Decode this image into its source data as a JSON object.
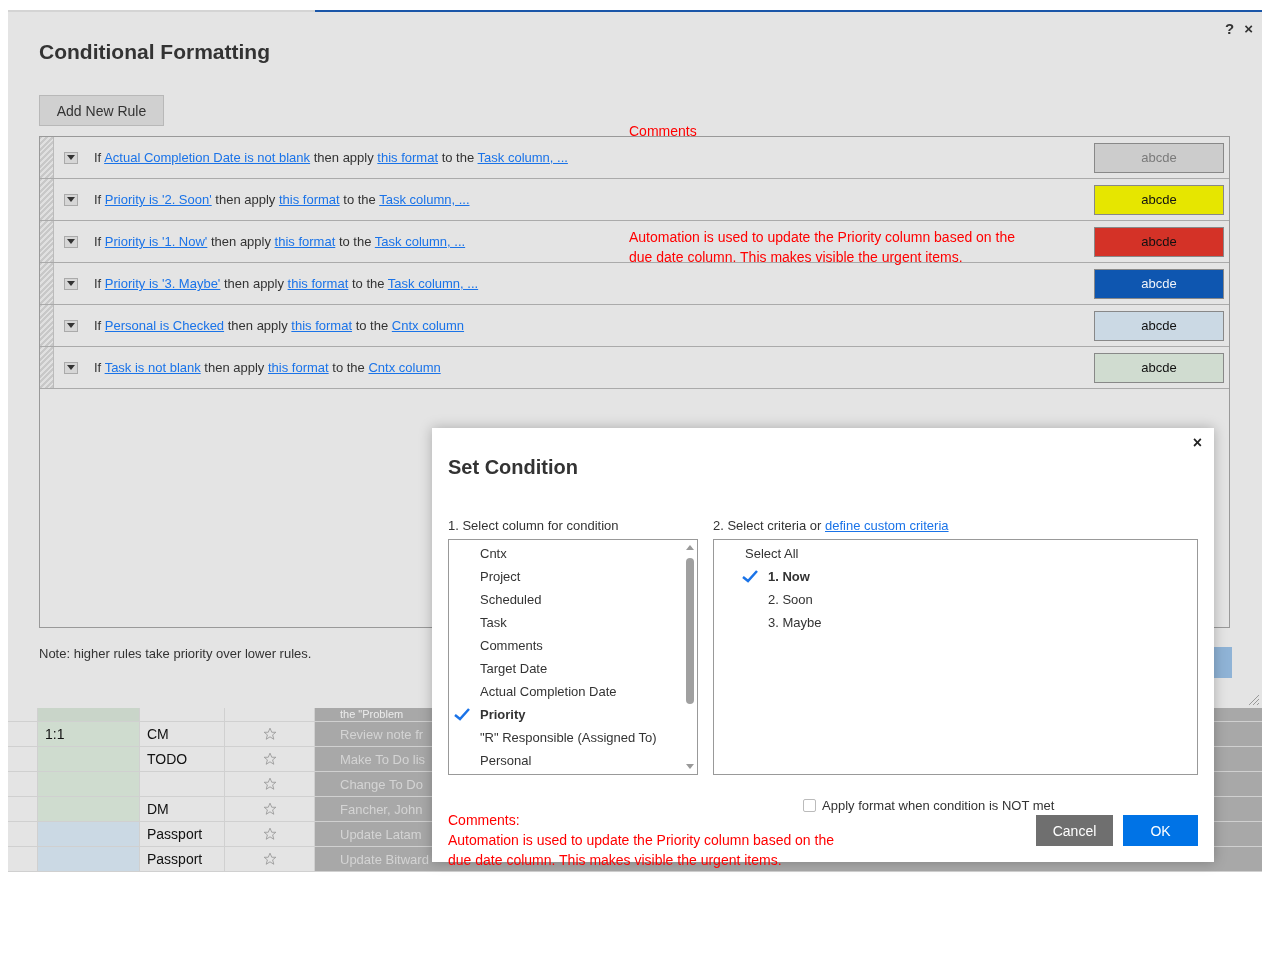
{
  "dialog": {
    "title": "Conditional Formatting",
    "help": "?",
    "close": "×",
    "add_button": "Add New Rule",
    "comment_label": "Comments",
    "comment_note": "Automation is used to update the Priority column based on the due date column.  This makes visible the urgent items.",
    "rules": [
      {
        "parts": [
          {
            "text": "If",
            "kind": "text"
          },
          {
            "text": "Actual Completion Date is not blank",
            "kind": "link"
          },
          {
            "text": "then apply",
            "kind": "text"
          },
          {
            "text": "this format",
            "kind": "link"
          },
          {
            "text": "to the",
            "kind": "text"
          },
          {
            "text": "Task column, ...",
            "kind": "link"
          }
        ],
        "sample": "abcde",
        "color": "#cccccc",
        "muted": true
      },
      {
        "parts": [
          {
            "text": "If",
            "kind": "text"
          },
          {
            "text": "Priority is '2. Soon'",
            "kind": "link"
          },
          {
            "text": "then apply",
            "kind": "text"
          },
          {
            "text": "this format",
            "kind": "link"
          },
          {
            "text": "to the",
            "kind": "text"
          },
          {
            "text": "Task column, ...",
            "kind": "link"
          }
        ],
        "sample": "abcde",
        "color": "#e6e600"
      },
      {
        "parts": [
          {
            "text": "If",
            "kind": "text"
          },
          {
            "text": "Priority is '1. Now'",
            "kind": "link"
          },
          {
            "text": "then apply",
            "kind": "text"
          },
          {
            "text": "this format",
            "kind": "link"
          },
          {
            "text": "to the",
            "kind": "text"
          },
          {
            "text": "Task column, ...",
            "kind": "link"
          }
        ],
        "sample": "abcde",
        "color": "#d43227"
      },
      {
        "parts": [
          {
            "text": "If",
            "kind": "text"
          },
          {
            "text": "Priority is '3. Maybe'",
            "kind": "link"
          },
          {
            "text": "then apply",
            "kind": "text"
          },
          {
            "text": "this format",
            "kind": "link"
          },
          {
            "text": "to the",
            "kind": "text"
          },
          {
            "text": "Task column, ...",
            "kind": "link"
          }
        ],
        "sample": "abcde",
        "color": "#0e56b0"
      },
      {
        "parts": [
          {
            "text": "If",
            "kind": "text"
          },
          {
            "text": "Personal is Checked",
            "kind": "link"
          },
          {
            "text": "then apply",
            "kind": "text"
          },
          {
            "text": "this format",
            "kind": "link"
          },
          {
            "text": "to the",
            "kind": "text"
          },
          {
            "text": "Cntx column",
            "kind": "link"
          }
        ],
        "sample": "abcde",
        "color": "#cbd9e4"
      },
      {
        "parts": [
          {
            "text": "If",
            "kind": "text"
          },
          {
            "text": "Task is not blank",
            "kind": "link"
          },
          {
            "text": "then apply",
            "kind": "text"
          },
          {
            "text": "this format",
            "kind": "link"
          },
          {
            "text": "to the",
            "kind": "text"
          },
          {
            "text": "Cntx column",
            "kind": "link"
          }
        ],
        "sample": "abcde",
        "color": "#d0dcd0"
      }
    ],
    "footnote": "Note: higher rules take priority over lower rules."
  },
  "sheet": {
    "top_row": {
      "task": "the \"Problem",
      "color": "#c9d5c9"
    },
    "rows": [
      {
        "cell_1": "1:1",
        "cell_2": "CM",
        "task": "Review note fr",
        "color": "#cfdccf"
      },
      {
        "cell_1": "",
        "cell_2": "TODO",
        "task": "Make To Do lis",
        "color": "#cfdccf"
      },
      {
        "cell_1": "",
        "cell_2": "",
        "task": "Change To Do",
        "color": "#cfdccf"
      },
      {
        "cell_1": "",
        "cell_2": "DM",
        "task": "Fancher, John",
        "color": "#cfdccf"
      },
      {
        "cell_1": "",
        "cell_2": "Passport",
        "task": "Update Latam",
        "color": "#cbd9e4"
      },
      {
        "cell_1": "",
        "cell_2": "Passport",
        "task": "Update Bitward",
        "color": "#cbd9e4"
      }
    ]
  },
  "set_condition": {
    "title": "Set Condition",
    "close": "×",
    "column_label": "1. Select column for condition",
    "columns": [
      {
        "label": "Cntx",
        "selected": false
      },
      {
        "label": "Project",
        "selected": false
      },
      {
        "label": "Scheduled",
        "selected": false
      },
      {
        "label": "Task",
        "selected": false
      },
      {
        "label": "Comments",
        "selected": false
      },
      {
        "label": "Target Date",
        "selected": false
      },
      {
        "label": "Actual Completion Date",
        "selected": false
      },
      {
        "label": "Priority",
        "selected": true
      },
      {
        "label": "\"R\" Responsible (Assigned To)",
        "selected": false
      },
      {
        "label": "Personal",
        "selected": false
      }
    ],
    "criteria_label": "2. Select criteria or",
    "criteria_link": "define custom criteria",
    "criteria": [
      {
        "label": "Select All",
        "kind": "all",
        "selected": false
      },
      {
        "label": "1. Now",
        "kind": "value",
        "selected": true
      },
      {
        "label": "2. Soon",
        "kind": "value",
        "selected": false
      },
      {
        "label": "3. Maybe",
        "kind": "value",
        "selected": false
      }
    ],
    "invert": {
      "label": "Apply format when condition is NOT met",
      "checked": false
    },
    "comment_title": "Comments:",
    "comment_text": "Automation is used to update the Priority column based on the due date column.  This makes visible the urgent items.",
    "cancel": "Cancel",
    "ok": "OK"
  }
}
